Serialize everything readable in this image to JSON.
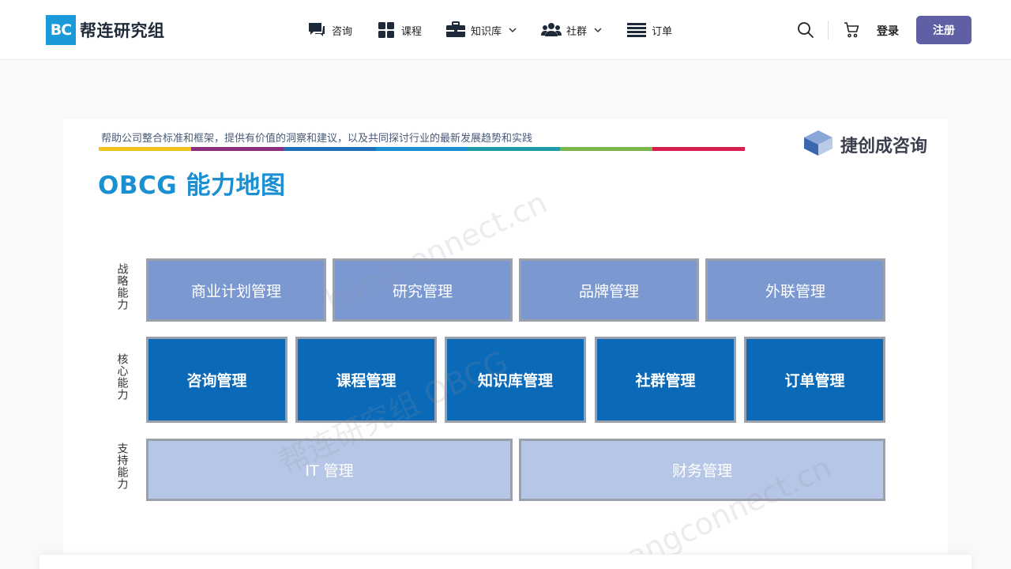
{
  "header": {
    "logo_badge": "BC",
    "logo_text": "帮连研究组",
    "nav": [
      {
        "label": "咨询",
        "icon": "chat-bubble-icon",
        "has_dropdown": false
      },
      {
        "label": "课程",
        "icon": "grid-icon",
        "has_dropdown": false
      },
      {
        "label": "知识库",
        "icon": "briefcase-icon",
        "has_dropdown": true
      },
      {
        "label": "社群",
        "icon": "users-icon",
        "has_dropdown": true
      },
      {
        "label": "订单",
        "icon": "list-icon",
        "has_dropdown": false
      }
    ],
    "login_label": "登录",
    "register_label": "注册"
  },
  "slide": {
    "tagline": "帮助公司整合标准和框架，提供有价值的洞察和建议，以及共同探讨行业的最新发展趋势和实践",
    "brand_name": "捷创成咨询",
    "title": "OBCG 能力地图",
    "colorbar": [
      "#f0c419",
      "#8c2e7c",
      "#1f6fb8",
      "#1a8fd2",
      "#1c9aa5",
      "#7ab648",
      "#d41f4f"
    ],
    "rows": [
      {
        "label": "战略能力",
        "items": [
          "商业计划管理",
          "研究管理",
          "品牌管理",
          "外联管理"
        ]
      },
      {
        "label": "核心能力",
        "items": [
          "咨询管理",
          "课程管理",
          "知识库管理",
          "社群管理",
          "订单管理"
        ]
      },
      {
        "label": "支持能力",
        "items": [
          "IT 管理",
          "财务管理"
        ]
      }
    ],
    "watermarks": [
      "bangconnect.cn",
      "bangconnect.cn",
      "帮连研究组 OBCG"
    ]
  },
  "colors": {
    "accent": "#5e5fa4",
    "logo_blue": "#1a9ad9",
    "strategic": "#7b98d0",
    "core": "#0a6ab8",
    "support": "#b6c6e6"
  }
}
